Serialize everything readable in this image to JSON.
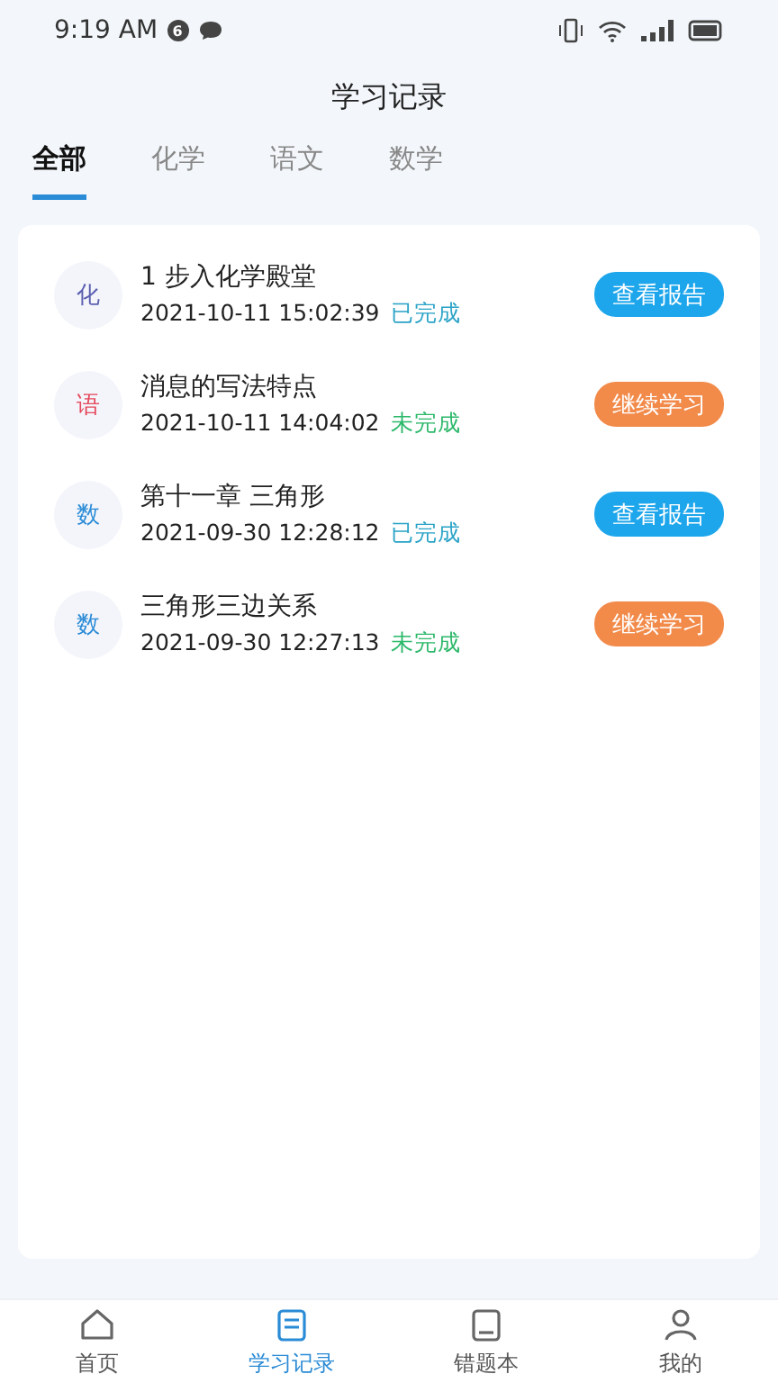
{
  "status_bar": {
    "time": "9:19 AM",
    "badge": "6"
  },
  "title": "学习记录",
  "tabs": [
    {
      "label": "全部",
      "selected": true
    },
    {
      "label": "化学",
      "selected": false
    },
    {
      "label": "语文",
      "selected": false
    },
    {
      "label": "数学",
      "selected": false
    }
  ],
  "records": [
    {
      "subject": "化",
      "color": "#5b5fb0",
      "title": "1 步入化学殿堂",
      "time": "2021-10-11 15:02:39",
      "status": "已完成",
      "completed": true,
      "action": "查看报告"
    },
    {
      "subject": "语",
      "color": "#e5485b",
      "title": "消息的写法特点",
      "time": "2021-10-11 14:04:02",
      "status": "未完成",
      "completed": false,
      "action": "继续学习"
    },
    {
      "subject": "数",
      "color": "#2a8bd6",
      "title": "第十一章 三角形",
      "time": "2021-09-30 12:28:12",
      "status": "已完成",
      "completed": true,
      "action": "查看报告"
    },
    {
      "subject": "数",
      "color": "#2a8bd6",
      "title": "三角形三边关系",
      "time": "2021-09-30 12:27:13",
      "status": "未完成",
      "completed": false,
      "action": "继续学习"
    }
  ],
  "nav": [
    {
      "label": "首页",
      "kind": "home",
      "selected": false
    },
    {
      "label": "学习记录",
      "kind": "record",
      "selected": true
    },
    {
      "label": "错题本",
      "kind": "book",
      "selected": false
    },
    {
      "label": "我的",
      "kind": "user",
      "selected": false
    }
  ]
}
